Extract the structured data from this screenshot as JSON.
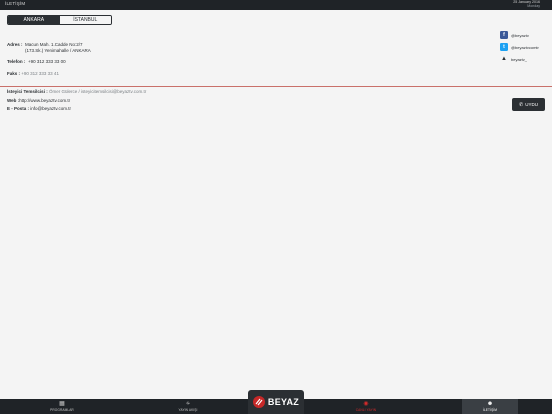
{
  "header": {
    "title": "İLETİŞİM",
    "date": "25 January 2016",
    "date_sub": "Monday"
  },
  "segment": {
    "ankara": "ANKARA",
    "istanbul": "İSTANBUL"
  },
  "contact": {
    "address_label": "Adres :",
    "address_line1": "Macun Mah. 1.Cadde No:2/7",
    "address_line2": "(173.Sk.) Yenimahalle / ANKARA",
    "phone_label": "Telefon :",
    "phone_value": "+90 312 333 33 00",
    "fax_label": "Faks :",
    "fax_value": "+90 312 333 33 41"
  },
  "social": {
    "facebook": "@beyaztv",
    "twitter": "@beyaztvcomtr",
    "other": "beyaztv_"
  },
  "footer_info": {
    "requests_label": "İsteyici Temsilcisi :",
    "requests_value": "Ömer Gülerce / isteyicitemsilcisi@beyaztv.com.tr",
    "web_label": "Web :",
    "web_value": "http://www.beyaztv.com.tr",
    "email_label": "E - Posta :",
    "email_value": "info@beyaztv.com.tr"
  },
  "uydu_button": "UYDU",
  "logo_text": "BEYAZ",
  "tabs": {
    "programlar": "PROGRAMLAR",
    "yayin_akisi": "YAYIN AKIŞI",
    "canli_yayin": "CANLI YAYIN",
    "iletisim": "İLETİŞİM"
  },
  "colors": {
    "accent_red": "#d62b2b",
    "divider": "#c9706a",
    "dark": "#2b2f33"
  }
}
